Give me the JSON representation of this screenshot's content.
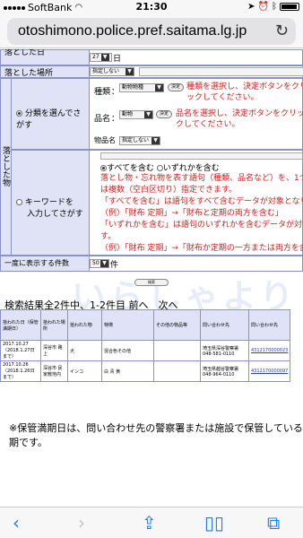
{
  "status_bar": {
    "carrier": "SoftBank",
    "time": "21:30"
  },
  "browser": {
    "url": "otoshimono.police.pref.saitama.lg.jp"
  },
  "form": {
    "date_row": {
      "label": "落とした日",
      "day_value": "27",
      "day_suffix": "日"
    },
    "place_row": {
      "label": "落とした場所",
      "select_value": "指定しない"
    },
    "item_label": "落とした物",
    "category_option": {
      "radio_label": "分類を選んでさがす",
      "kind_label": "種類",
      "kind_select": "動物物種",
      "kind_button": "決定",
      "kind_hint": "種類を選択し、決定ボタンをクリックしてください。",
      "name_label": "品名",
      "name_select": "動物",
      "name_button": "決定",
      "name_hint": "品名を選択し、決定ボタンをクリックしてください。",
      "itemname_label": "物品名",
      "itemname_select": "指定しない"
    },
    "keyword_option": {
      "radio_label_1": "キーワードを",
      "radio_label_2": "入力してさがす",
      "match_all": "すべてを含む",
      "match_any": "いずれかを含む",
      "help_lines": [
        "落とし物・忘れ物を表す語句（種類、品名など）を、1つ、",
        "は複数（空白区切り）指定できます。",
        "「すべてを含む」は語句をすべて含むデータが対象となりま",
        "（例）「財布 定期」→「財布と定期の両方を含む」",
        "「いずれかを含む」は語句のいずれかを含むデータが対象と",
        "す。",
        "（例）「財布 定期」→「財布か定期の一方または両方を含"
      ]
    },
    "per_page_row": {
      "label": "一度に表示する件数",
      "select_value": "50",
      "suffix": "件"
    },
    "search_button": "検索"
  },
  "results": {
    "summary": "検索結果全2件中、1-2件目 前へ　次へ",
    "headers": [
      "拾われた日（保管満期日）",
      "拾われた場所",
      "拾われた物",
      "特徴",
      "その他の物品等",
      "問い合わせ先",
      "問い合わせ先"
    ],
    "rows": [
      [
        "2017.10.27（2018.1.27日まで）",
        "深谷市 路上",
        "犬",
        "混合色その他",
        "",
        "埼玉県深谷警察署 048-581-0110",
        "4312170000023"
      ],
      [
        "2017.10.26（2018.1.26日まで）",
        "深谷市 民家敷地内",
        "インコ",
        "白 青 黄",
        "",
        "埼玉県越谷警察署 048-964-0110",
        "4312170000097"
      ]
    ]
  },
  "note": "※保管満期日は、問い合わせ先の警察署または施設で保管している期です。",
  "colors": {
    "header_bg": "#dfe3f5",
    "border": "#8a93c8",
    "hint_red": "#d02020",
    "ios_blue": "#1a7cf5"
  }
}
